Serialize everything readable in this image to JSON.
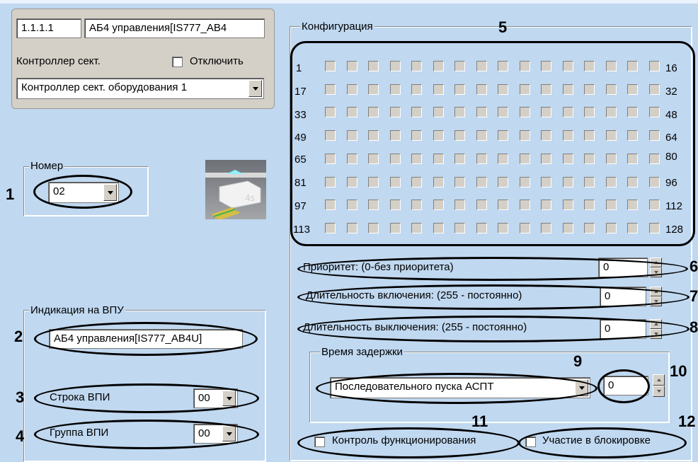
{
  "header": {
    "id_value": "1.1.1.1",
    "name_value": "АБ4 управления[IS777_AB4",
    "controller_label": "Контроллер сект.",
    "disable_label": "Отключить",
    "controller_select_value": "Контроллер сект. оборудования 1"
  },
  "number_group": {
    "title": "Номер",
    "select_value": "02"
  },
  "indication_group": {
    "title": "Индикация на ВПУ",
    "name_value": "АБ4 управления[IS777_AB4U]",
    "row_label": "Строка ВПИ",
    "row_value": "00",
    "group_label": "Группа ВПИ",
    "group_value": "00"
  },
  "config_group": {
    "title": "Конфигурация",
    "row_start_labels": [
      "1",
      "17",
      "33",
      "49",
      "65",
      "81",
      "97",
      "113"
    ],
    "row_end_labels": [
      "16",
      "32",
      "48",
      "64",
      "80",
      "96",
      "112",
      "128"
    ],
    "priority_label": "Приоритет: (0-без приоритета)",
    "priority_value": "0",
    "on_duration_label": "Длительность включения: (255 - постоянно)",
    "on_duration_value": "0",
    "off_duration_label": "Длительность выключения: (255 - постоянно)",
    "off_duration_value": "0",
    "delay_title": "Время задержки",
    "delay_select_value": "Последовательного пуска АСПТ",
    "delay_value": "0",
    "control_label": "Контроль функционирования",
    "blocking_label": "Участие в блокировке"
  },
  "callouts": [
    "1",
    "2",
    "3",
    "4",
    "5",
    "6",
    "7",
    "8",
    "9",
    "10",
    "11",
    "12"
  ],
  "colors": {
    "background": "#c0d8f0",
    "panel": "#d4d0c8"
  }
}
